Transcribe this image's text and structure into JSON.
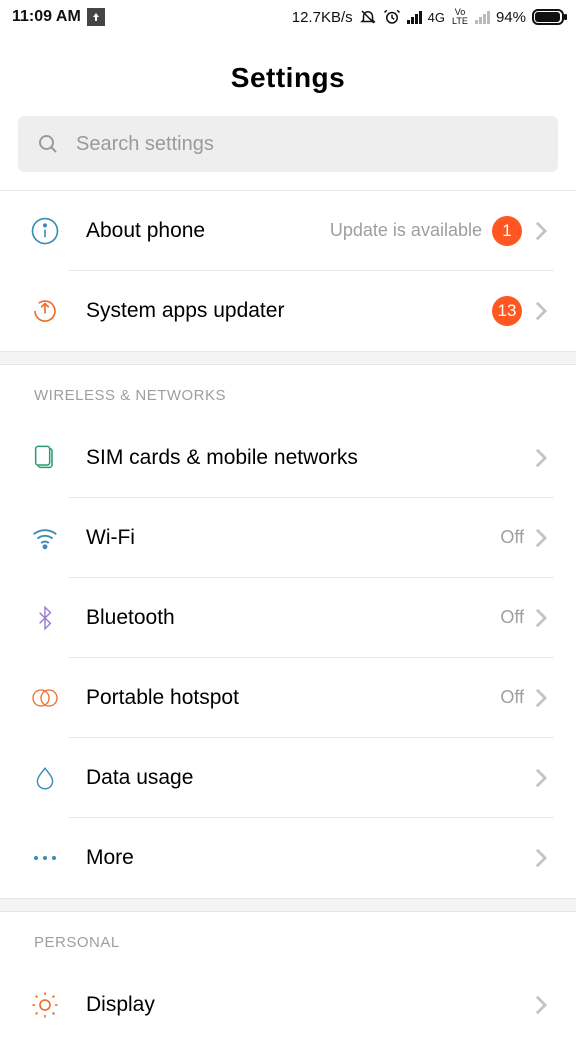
{
  "status": {
    "time": "11:09 AM",
    "speed": "12.7KB/s",
    "net_label": "4G",
    "volte": "Vo LTE",
    "battery_pct": "94%"
  },
  "title": "Settings",
  "search": {
    "placeholder": "Search settings"
  },
  "top": {
    "about": {
      "label": "About phone",
      "note": "Update is available",
      "badge": "1"
    },
    "updater": {
      "label": "System apps updater",
      "badge": "13"
    }
  },
  "sections": {
    "wireless_header": "WIRELESS & NETWORKS",
    "sim": {
      "label": "SIM cards & mobile networks"
    },
    "wifi": {
      "label": "Wi-Fi",
      "value": "Off"
    },
    "bluetooth": {
      "label": "Bluetooth",
      "value": "Off"
    },
    "hotspot": {
      "label": "Portable hotspot",
      "value": "Off"
    },
    "data": {
      "label": "Data usage"
    },
    "more": {
      "label": "More"
    },
    "personal_header": "PERSONAL",
    "display": {
      "label": "Display"
    }
  }
}
